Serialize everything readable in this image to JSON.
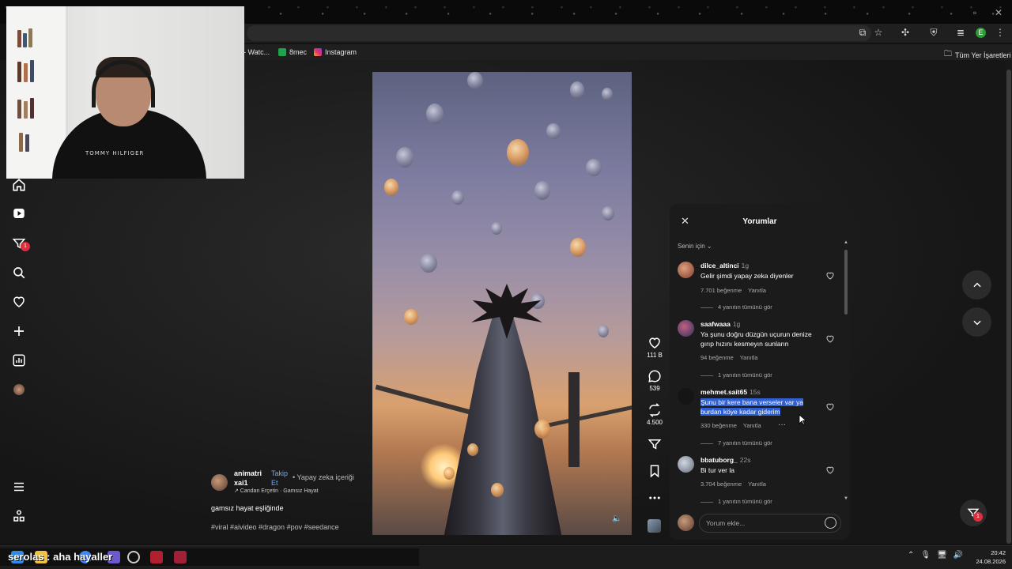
{
  "browser": {
    "bookmarks": [
      {
        "label": "- Watc..."
      },
      {
        "label": "8mec"
      },
      {
        "label": "Instagram"
      }
    ],
    "all_bookmarks_label": "Tüm Yer İşaretleri",
    "profile_initial": "E"
  },
  "nav": {
    "inbox_badge": "1"
  },
  "post": {
    "author": "animatri xai1",
    "follow_label": "Takip Et",
    "ai_label": "• Yapay zeka içeriği",
    "sound": "↗ Candan Erçetin · Gamsız Hayat",
    "caption": "gamsız hayat eşliğinde",
    "hashtags": "#viral #aivideo #dragon #pov #seedance"
  },
  "actions": {
    "likes": "111 B",
    "comments": "539",
    "reposts": "4.500"
  },
  "comments_panel": {
    "title": "Yorumlar",
    "filter": "Senin için",
    "input_placeholder": "Yorum ekle...",
    "reply_label": "Yanıtla",
    "items": [
      {
        "user": "dilce_altinci",
        "time": "1g",
        "text": "Gelir şimdi yapay zeka diyenler",
        "likes": "7.701 beğenme",
        "replies": "4 yanıtın tümünü gör"
      },
      {
        "user": "saafwaaa",
        "time": "1g",
        "text": "Ya şunu doğru düzgün uçurun denize gırıp hızını kesmeyın sunların",
        "likes": "94 beğenme",
        "replies": "1 yanıtın tümünü gör"
      },
      {
        "user": "mehmet.sait65",
        "time": "15s",
        "text": "Şunu bir kere bana verseler var ya burdan köye kadar giderim",
        "likes": "330 beğenme",
        "replies": "7 yanıtın tümünü gör"
      },
      {
        "user": "bbatuborg_",
        "time": "22s",
        "text": "Bi tur ver la",
        "likes": "3.704 beğenme",
        "replies": "1 yanıtın tümünü gör"
      }
    ]
  },
  "webcam": {
    "shirt_text": "TOMMY HILFIGER"
  },
  "taskbar": {
    "overlay_text": "serolas : aha hayaller",
    "time": "20:42",
    "date": "24.08.2026"
  }
}
